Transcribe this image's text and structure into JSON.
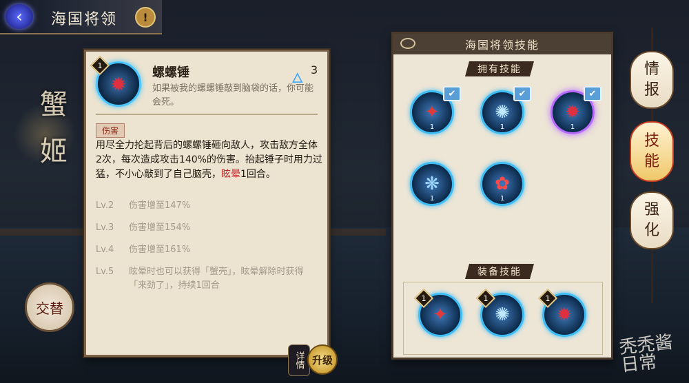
{
  "header": {
    "title": "海国将领",
    "back_icon": "back-arrow-icon",
    "warn_symbol": "!"
  },
  "side_decoration": "蟹\n姬",
  "detail": {
    "level": "1",
    "skill_name": "螺螺锤",
    "cost": "3",
    "flavor": "如果被我的螺螺锤敲到脑袋的话，你可能会死。",
    "tag": "伤害",
    "desc_part1": "用尽全力抡起背后的螺螺锤砸向敌人，攻击敌方全体2次，每次造成攻击140%的伤害。抬起锤子时用力过猛，不小心敲到了自己脑壳，",
    "desc_red": "眩晕",
    "desc_part2": "1回合。",
    "levels": [
      {
        "lv": "Lv.2",
        "text": "伤害增至147%"
      },
      {
        "lv": "Lv.3",
        "text": "伤害增至154%"
      },
      {
        "lv": "Lv.4",
        "text": "伤害增至161%"
      },
      {
        "lv": "Lv.5",
        "text": "眩晕时也可以获得「蟹壳」，眩晕解除时获得「来劲了」，持续1回合"
      }
    ]
  },
  "buttons": {
    "swap": "交替",
    "details": "详情",
    "upgrade": "升级"
  },
  "skills_panel": {
    "title": "海国将领技能",
    "owned_label": "拥有技能",
    "equipped_label": "装备技能",
    "owned": [
      {
        "name": "claw-skill",
        "level": "1",
        "checked": true,
        "selected": false
      },
      {
        "name": "burst-skill",
        "level": "1",
        "checked": true,
        "selected": false
      },
      {
        "name": "hammer-skill",
        "level": "1",
        "checked": true,
        "selected": true
      },
      {
        "name": "spirit-skill",
        "level": "1",
        "checked": false,
        "selected": false
      },
      {
        "name": "crab-skill",
        "level": "1",
        "checked": false,
        "selected": false
      }
    ],
    "equipped": [
      {
        "name": "claw-skill",
        "level": "1"
      },
      {
        "name": "burst-skill",
        "level": "1"
      },
      {
        "name": "hammer-skill",
        "level": "1"
      }
    ]
  },
  "tabs": [
    {
      "label": "情\n报",
      "active": false
    },
    {
      "label": "技\n能",
      "active": true
    },
    {
      "label": "强\n化",
      "active": false
    }
  ],
  "watermark": "秃秃酱\n日常",
  "colors": {
    "accent_blue": "#3fbef5",
    "selected_purple": "#b66bff",
    "stun_red": "#c0282a"
  }
}
